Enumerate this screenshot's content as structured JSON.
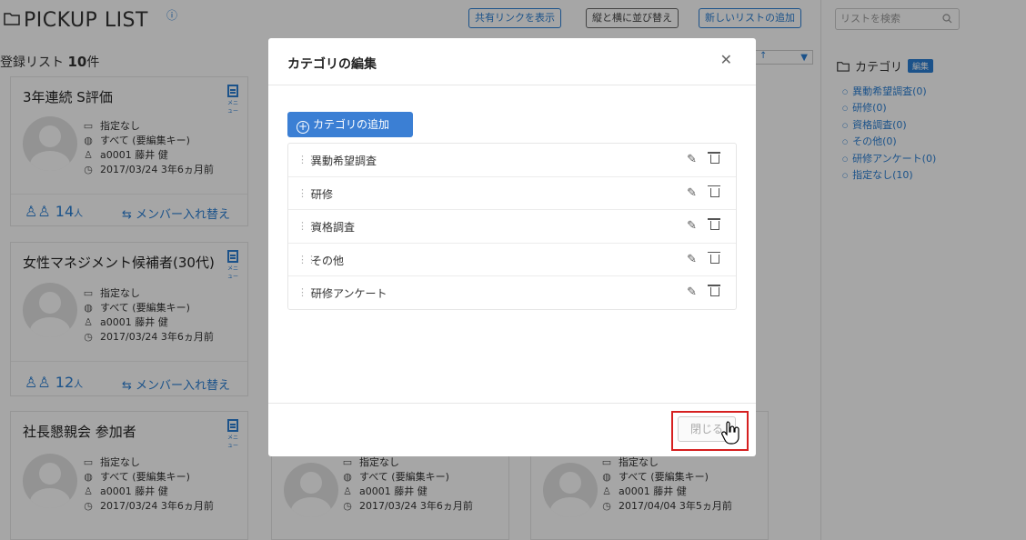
{
  "header": {
    "title": "PICKUP LIST",
    "help_icon": "?",
    "buttons": [
      "共有リンクを表示",
      "縦と横に並び替え",
      "新しいリストの追加"
    ],
    "search_placeholder": "リストを検索"
  },
  "list_count": {
    "prefix": "登録リスト ",
    "count": "10",
    "suffix": "件"
  },
  "sidebar": {
    "title": "カテゴリ",
    "edit_label": "編集",
    "items": [
      "異動希望調査(0)",
      "研修(0)",
      "資格調査(0)",
      "その他(0)",
      "研修アンケート(0)",
      "指定なし(10)"
    ]
  },
  "cards": [
    {
      "title": "3年連続 S評価",
      "menu_label": "メニュー",
      "category": "指定なし",
      "scope": "すべて (要編集キー)",
      "owner": "a0001 藤井 健",
      "date": "2017/03/24 3年6ヵ月前",
      "member_count": "14",
      "member_unit": "人",
      "swap_label": "メンバー入れ替え"
    },
    {
      "title": "女性マネジメント候補者(30代)",
      "menu_label": "メニュー",
      "category": "指定なし",
      "scope": "すべて (要編集キー)",
      "owner": "a0001 藤井 健",
      "date": "2017/03/24 3年6ヵ月前",
      "member_count": "12",
      "member_unit": "人",
      "swap_label": "メンバー入れ替え"
    },
    {
      "title": "社長懇親会 参加者",
      "menu_label": "メニュー",
      "category": "指定なし",
      "scope": "すべて (要編集キー)",
      "owner": "a0001 藤井 健",
      "date": "2017/03/24 3年6ヵ月前"
    }
  ],
  "bottom_cards": [
    {
      "category": "指定なし",
      "scope": "すべて (要編集キー)",
      "owner": "a0001 藤井 健",
      "date": "2017/03/24 3年6ヵ月前"
    },
    {
      "category": "指定なし",
      "scope": "すべて (要編集キー)",
      "owner": "a0001 藤井 健",
      "date": "2017/04/04 3年5ヵ月前"
    }
  ],
  "modal": {
    "title": "カテゴリの編集",
    "add_label": "カテゴリの追加",
    "categories": [
      "異動希望調査",
      "研修",
      "資格調査",
      "その他",
      "研修アンケート"
    ],
    "close_label": "閉じる"
  }
}
